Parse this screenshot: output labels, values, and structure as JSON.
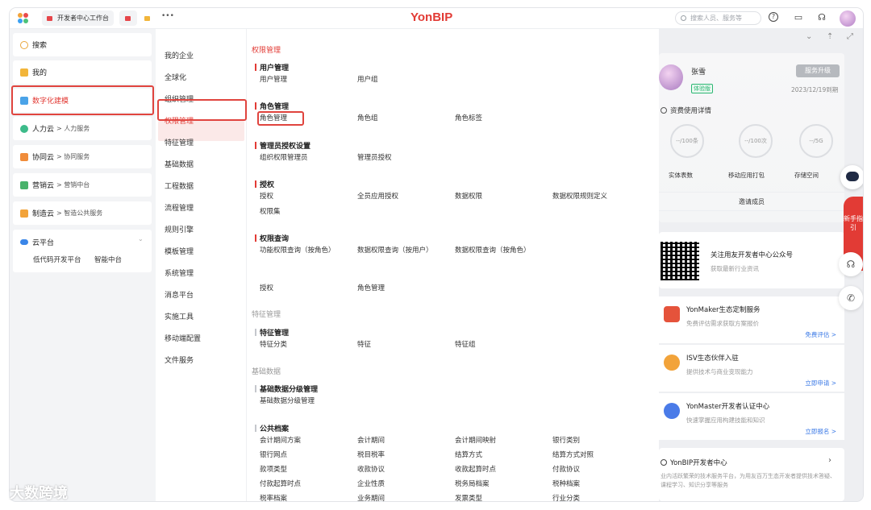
{
  "topbar": {
    "tab1_label": "开发者中心工作台",
    "more_label": "•••",
    "logo": "YonBIP",
    "search_placeholder": "搜索人员、服务等"
  },
  "left_menu": {
    "items": [
      {
        "label": "搜索",
        "sub": ""
      },
      {
        "label": "我的",
        "sub": ""
      },
      {
        "label": "数字化建模",
        "sub": ""
      },
      {
        "label": "人力云",
        "sub": "> 人力服务"
      },
      {
        "label": "协同云",
        "sub": "> 协同服务"
      },
      {
        "label": "营销云",
        "sub": "> 营销中台"
      },
      {
        "label": "制造云",
        "sub": "> 智造公共服务"
      }
    ],
    "cloud": {
      "label": "云平台",
      "children": [
        "低代码开发平台",
        "智能中台"
      ]
    }
  },
  "col2": {
    "items": [
      "我的企业",
      "全球化",
      "组织管理",
      "权限管理",
      "特征管理",
      "基础数据",
      "工程数据",
      "流程管理",
      "规则引擎",
      "模板管理",
      "系统管理",
      "消息平台",
      "实施工具",
      "移动端配置",
      "文件服务"
    ]
  },
  "col3": {
    "section_permission": "权限管理",
    "section_feature": "特征管理",
    "section_basic": "基础数据",
    "groups": {
      "user": {
        "title": "用户管理",
        "links": [
          "用户管理",
          "用户组"
        ]
      },
      "role": {
        "title": "角色管理",
        "links": [
          "角色管理",
          "角色组",
          "角色标签"
        ]
      },
      "admin": {
        "title": "管理员授权设置",
        "links": [
          "组织权限管理员",
          "管理员授权"
        ]
      },
      "auth": {
        "title": "授权",
        "links": [
          "授权",
          "全员应用授权",
          "数据权限",
          "数据权限规则定义",
          "权限集"
        ]
      },
      "query": {
        "title": "权限查询",
        "links": [
          "功能权限查询（按角色）",
          "数据权限查询（按用户）",
          "数据权限查询（按角色）",
          "授权",
          "角色管理"
        ]
      },
      "feature": {
        "title": "特征管理",
        "links": [
          "特征分类",
          "特征",
          "特征组"
        ]
      },
      "basiclevel": {
        "title": "基础数据分级管理",
        "links": [
          "基础数据分级管理"
        ]
      },
      "archive": {
        "title": "公共档案",
        "links": [
          "会计期间方案",
          "会计期间",
          "会计期间映射",
          "银行类别",
          "银行网点",
          "税目税率",
          "结算方式",
          "结算方式对照",
          "款项类型",
          "收款协议",
          "收款起算时点",
          "付款协议",
          "付款起算时点",
          "企业性质",
          "税务局档案",
          "税种档案",
          "税率档案",
          "业务期间",
          "发票类型",
          "行业分类"
        ]
      }
    }
  },
  "right": {
    "user_name": "张雪",
    "badge": "体验版",
    "upgrade": "服务升级",
    "expire": "2023/12/19到期",
    "usage_title": "资费使用详情",
    "circles": [
      {
        "value": "--/100条",
        "label": "实体表数"
      },
      {
        "value": "--/100次",
        "label": "移动应用打包"
      },
      {
        "value": "--/5G",
        "label": "存储空间"
      }
    ],
    "invite": "邀请成员",
    "qr_title": "关注用友开发者中心公众号",
    "qr_sub": "获取最新行业资讯",
    "services": [
      {
        "title": "YonMaker生态定制服务",
        "sub": "免费评估需求获取方案报价",
        "link": "免费评估 >"
      },
      {
        "title": "ISV生态伙伴入驻",
        "sub": "提供技术与商业变现能力",
        "link": "立即申请 >"
      },
      {
        "title": "YonMaster开发者认证中心",
        "sub": "快速掌握应用构建技能和知识",
        "link": "立即报名 >"
      }
    ],
    "dev_title": "YonBIP开发者中心",
    "dev_desc": "业内活跃繁荣的技术服务平台，为用友百万生态开发者提供技术答疑、课程学习、知识分享等服务",
    "guide": "新手指引"
  },
  "watermark": "大数跨境",
  "colors": {
    "brand_red": "#e23b35",
    "link_blue": "#3978e6"
  }
}
